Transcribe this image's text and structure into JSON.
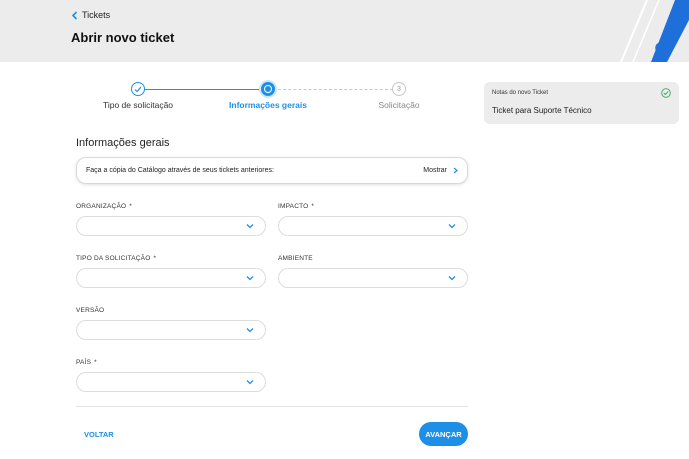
{
  "header": {
    "back_label": "Tickets",
    "title": "Abrir novo ticket"
  },
  "stepper": {
    "steps": [
      {
        "label": "Tipo de solicitação",
        "state": "done"
      },
      {
        "label": "Informações gerais",
        "state": "active"
      },
      {
        "label": "Solicitação",
        "state": "pending",
        "number": "3"
      }
    ]
  },
  "form": {
    "section_title": "Informações gerais",
    "catalog_text": "Faça a cópia do Catálogo através de seus tickets anteriores:",
    "catalog_action": "Mostrar",
    "fields": {
      "organizacao": {
        "label": "ORGANIZAÇÃO",
        "required": "*",
        "value": ""
      },
      "impacto": {
        "label": "IMPACTO",
        "required": "*",
        "value": ""
      },
      "tipo": {
        "label": "TIPO DA SOLICITAÇÃO",
        "required": "*",
        "value": ""
      },
      "ambiente": {
        "label": "AMBIENTE",
        "value": ""
      },
      "versao": {
        "label": "VERSÃO",
        "value": ""
      },
      "pais": {
        "label": "PAÍS",
        "required": "*",
        "value": ""
      }
    }
  },
  "actions": {
    "back_label": "VOLTAR",
    "next_label": "AVANÇAR"
  },
  "notes": {
    "title": "Notas do novo Ticket",
    "value": "Ticket para Suporte Técnico"
  },
  "colors": {
    "accent": "#1e8fe6",
    "header_bg": "#ececec",
    "success": "#2eaa5c"
  }
}
